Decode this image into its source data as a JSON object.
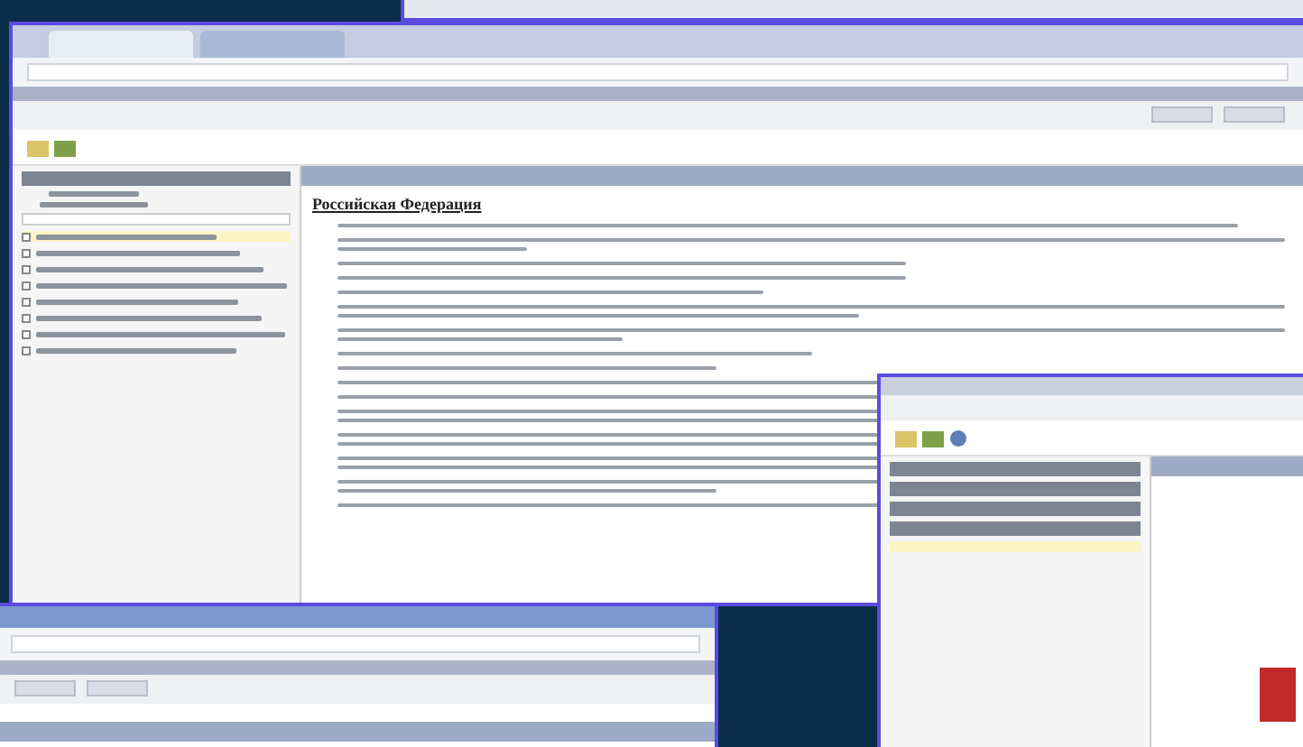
{
  "main_window": {
    "document_heading": "Российская Федерация",
    "sidebar_items": [
      {
        "checked": false,
        "selected": true
      },
      {
        "checked": false,
        "selected": false
      },
      {
        "checked": false,
        "selected": false
      },
      {
        "checked": false,
        "selected": false
      },
      {
        "checked": false,
        "selected": false
      },
      {
        "checked": false,
        "selected": false
      },
      {
        "checked": false,
        "selected": false
      },
      {
        "checked": false,
        "selected": false
      }
    ]
  }
}
